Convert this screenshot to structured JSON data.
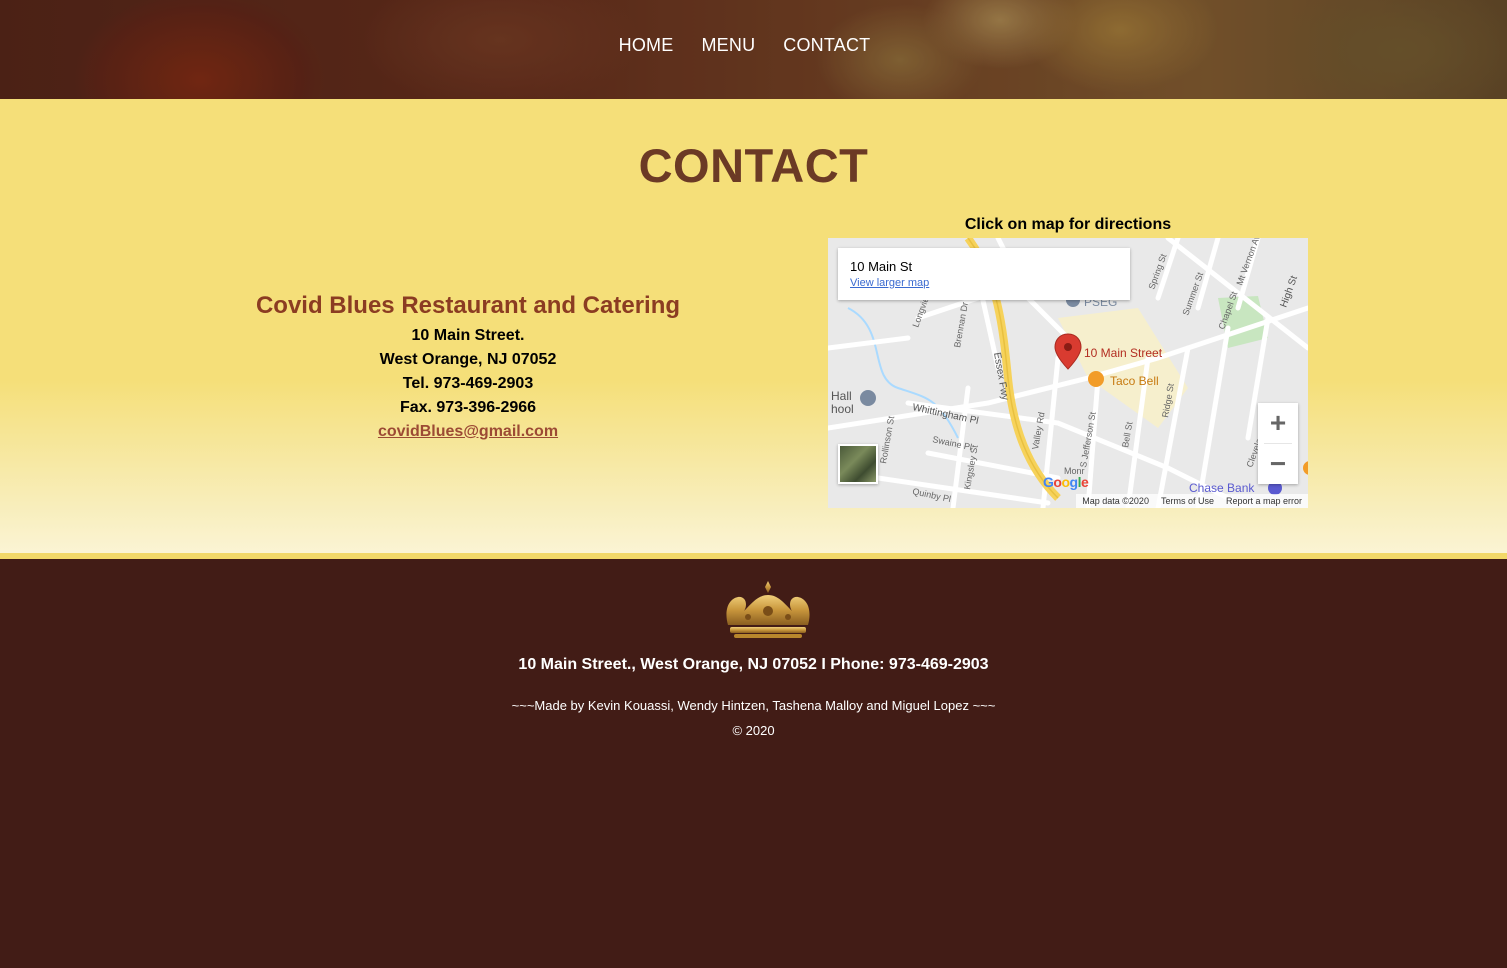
{
  "nav": {
    "items": [
      "HOME",
      "MENU",
      "CONTACT"
    ]
  },
  "page": {
    "title": "CONTACT"
  },
  "contact": {
    "name": "Covid Blues Restaurant and Catering",
    "street": "10 Main Street.",
    "city": "West Orange, NJ 07052",
    "tel": "Tel. 973-469-2903",
    "fax": "Fax. 973-396-2966",
    "email": "covidBlues@gmail.com"
  },
  "map": {
    "label": "Click on map for directions",
    "card_title": "10 Main St",
    "card_link": "View larger map",
    "pin_label": "10 Main Street",
    "poi_taco": "Taco Bell",
    "poi_bank": "Chase Bank",
    "poi_school": "Hall\nhool",
    "poi_pseg": "PSEG",
    "streets": {
      "essex": "Essex Fwy",
      "whittingham": "Whittingham Pl",
      "valley": "Valley Rd",
      "kingsley": "Kingsley St",
      "swaine": "Swaine Pl",
      "quinby": "Quinby Pl",
      "rollinson": "Rollinson St",
      "jefferson": "S Jefferson St",
      "bell": "Bell St",
      "ridge": "Ridge St",
      "high": "High St",
      "chapel": "Chapel St",
      "summer": "Summer St",
      "spring": "Spring St",
      "mtvernon": "Mt Vernon Av",
      "cleveland": "Cleveland St",
      "brennan": "Brennan Dr",
      "longview": "Longview",
      "monroe": "Monr"
    },
    "zoom_in": "+",
    "zoom_out": "−",
    "attribution": [
      "Map data ©2020",
      "Terms of Use",
      "Report a map error"
    ],
    "logo": "Google"
  },
  "footer": {
    "address": "10 Main Street., West Orange, NJ 07052  I  Phone: 973-469-2903",
    "credits": "~~~Made by Kevin Kouassi, Wendy Hintzen, Tashena Malloy and Miguel Lopez ~~~",
    "copyright": "© 2020"
  },
  "colors": {
    "accent": "#f5df79",
    "title": "#6b3a25",
    "footer_bg": "#421c16",
    "crown": "#c8963c"
  }
}
